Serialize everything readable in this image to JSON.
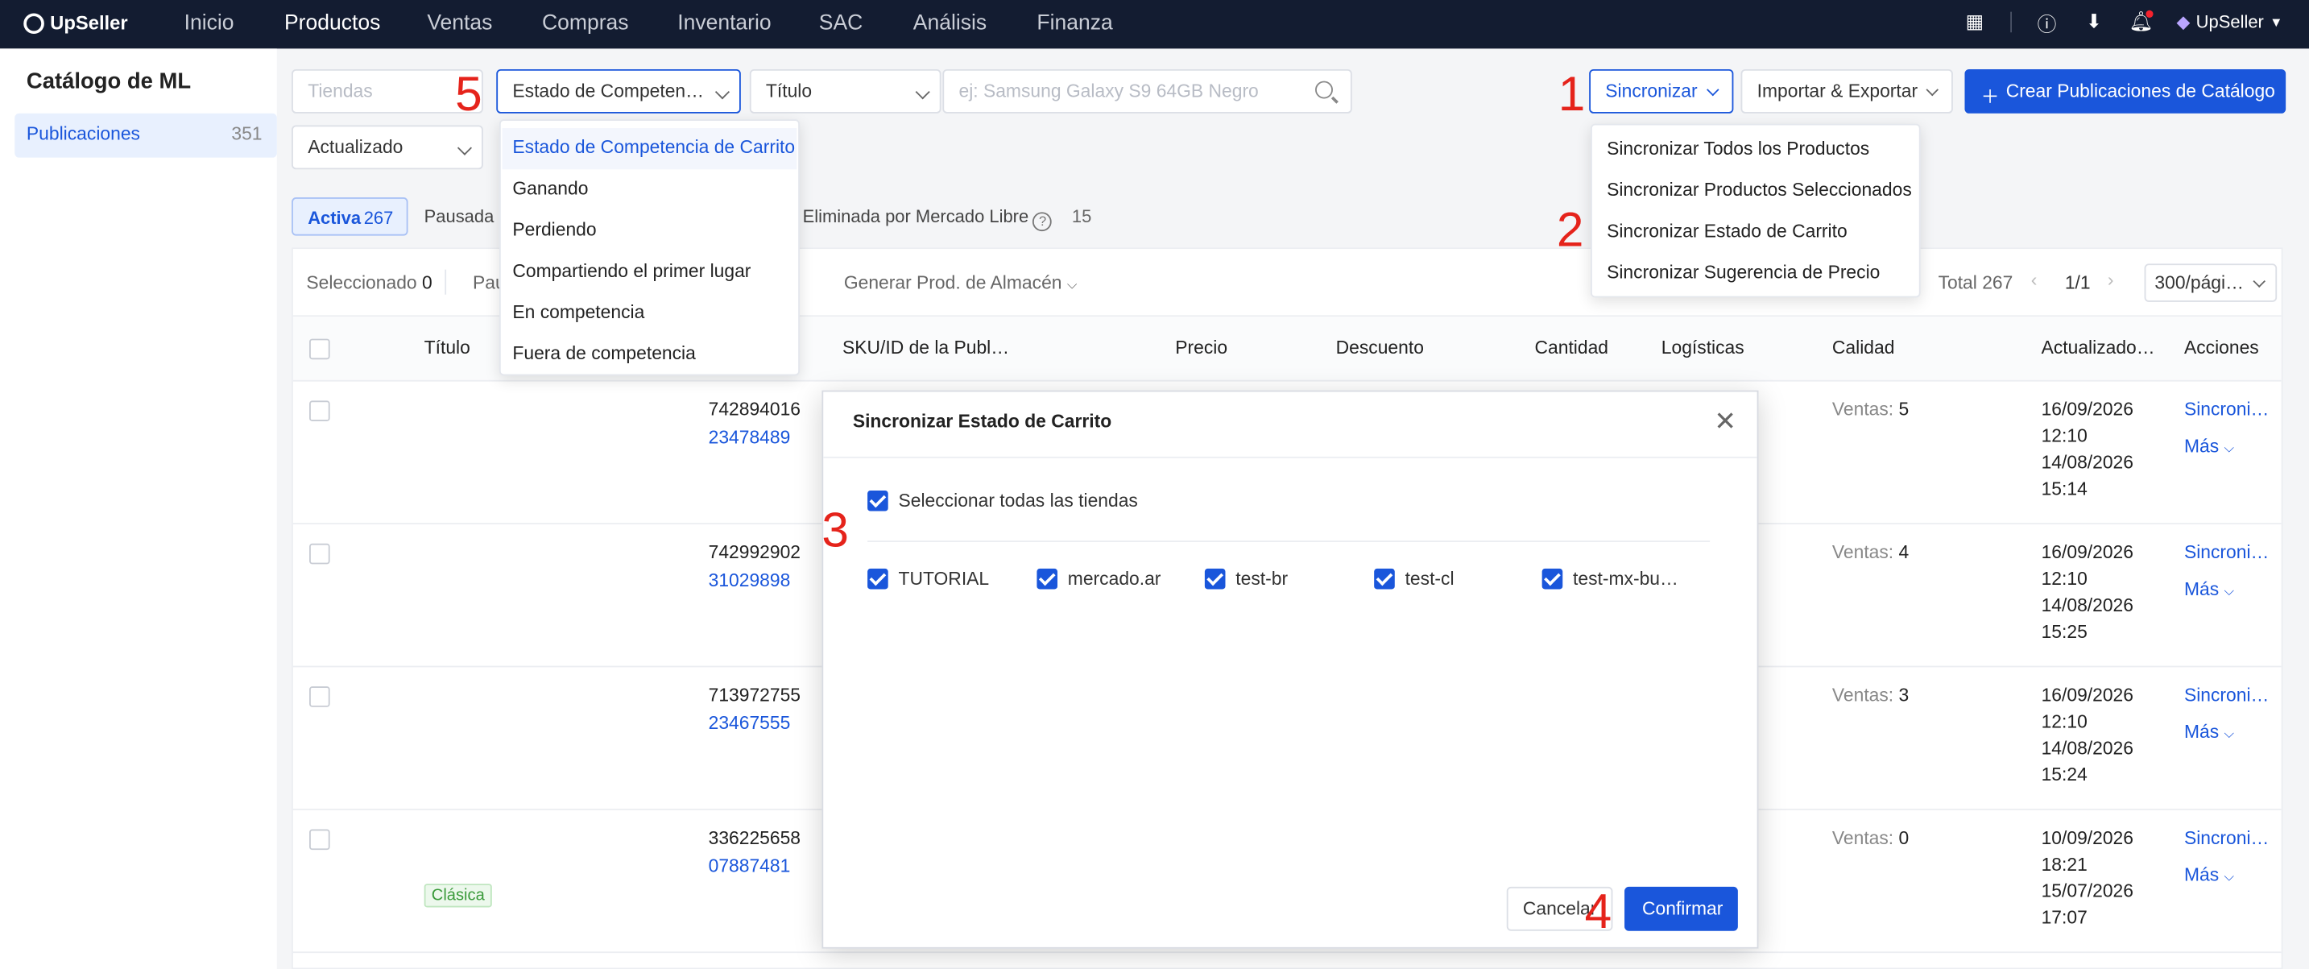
{
  "nav": {
    "brand": "UpSeller",
    "items": [
      "Inicio",
      "Productos",
      "Ventas",
      "Compras",
      "Inventario",
      "SAC",
      "Análisis",
      "Finanza"
    ],
    "active": "Productos",
    "user": "UpSeller"
  },
  "sidebar": {
    "title": "Catálogo de ML",
    "items": [
      {
        "label": "Publicaciones",
        "count": "351"
      }
    ]
  },
  "filters": {
    "tiendas_placeholder": "Tiendas",
    "estado_label": "Estado de Competen…",
    "titulo_label": "Título",
    "search_placeholder": "ej: Samsung Galaxy S9 64GB Negro",
    "actualizado_label": "Actualizado"
  },
  "actions": {
    "sincronizar": "Sincronizar",
    "importar": "Importar & Exportar",
    "crear": "Crear Publicaciones de Catálogo"
  },
  "status_tabs": {
    "active_label": "Activa",
    "active_count": "267",
    "pausada": "Pausada",
    "eliminada": "Eliminada por Mercado Libre",
    "eliminada_count": "15"
  },
  "toolbar": {
    "seleccionado": "Seleccionado",
    "seleccionado_count": "0",
    "pausar_partial": "Pau",
    "generar": "Generar Prod. de Almacén",
    "total": "Total 267",
    "page": "1/1",
    "per_page": "300/pági…"
  },
  "table": {
    "headers": [
      "Título",
      "SKU/ID de la Publ…",
      "Precio",
      "Descuento",
      "Cantidad",
      "Logísticas",
      "Calidad",
      "Actualizado…",
      "Acciones"
    ],
    "rows": [
      {
        "sku": "742894016",
        "id": "23478489",
        "ventas_label": "Ventas:",
        "ventas": "5",
        "upd1": "16/09/2026",
        "upd2": "12:10",
        "upd3": "14/08/2026",
        "upd4": "15:14",
        "sync": "Sincroni…",
        "mas": "Más"
      },
      {
        "sku": "742992902",
        "id": "31029898",
        "ventas_label": "Ventas:",
        "ventas": "4",
        "upd1": "16/09/2026",
        "upd2": "12:10",
        "upd3": "14/08/2026",
        "upd4": "15:25",
        "sync": "Sincroni…",
        "mas": "Más"
      },
      {
        "sku": "713972755",
        "id": "23467555",
        "ventas_label": "Ventas:",
        "ventas": "3",
        "upd1": "16/09/2026",
        "upd2": "12:10",
        "upd3": "14/08/2026",
        "upd4": "15:24",
        "sync": "Sincroni…",
        "mas": "Más"
      },
      {
        "sku": "336225658",
        "id": "07887481",
        "ventas_label": "Ventas:",
        "ventas": "0",
        "upd1": "10/09/2026",
        "upd2": "18:21",
        "upd3": "15/07/2026",
        "upd4": "17:07",
        "sync": "Sincroni…",
        "mas": "Más",
        "tag": "Clásica"
      }
    ]
  },
  "estado_dropdown": {
    "options": [
      "Estado de Competencia de Carrito",
      "Ganando",
      "Perdiendo",
      "Compartiendo el primer lugar",
      "En competencia",
      "Fuera de competencia"
    ],
    "selected": "Estado de Competencia de Carrito"
  },
  "sync_dropdown": {
    "options": [
      "Sincronizar Todos los Productos",
      "Sincronizar Productos Seleccionados",
      "Sincronizar Estado de Carrito",
      "Sincronizar Sugerencia de Precio"
    ]
  },
  "modal": {
    "title": "Sincronizar Estado de Carrito",
    "select_all": "Seleccionar todas las tiendas",
    "stores": [
      "TUTORIAL",
      "mercado.ar",
      "test-br",
      "test-cl",
      "test-mx-bu…"
    ],
    "cancel": "Cancelar",
    "confirm": "Confirmar"
  },
  "annotations": [
    "1",
    "2",
    "3",
    "4",
    "5"
  ],
  "colors": {
    "accent": "#1a56db",
    "nav_bg": "#131c31",
    "annotation": "#e5231b"
  }
}
